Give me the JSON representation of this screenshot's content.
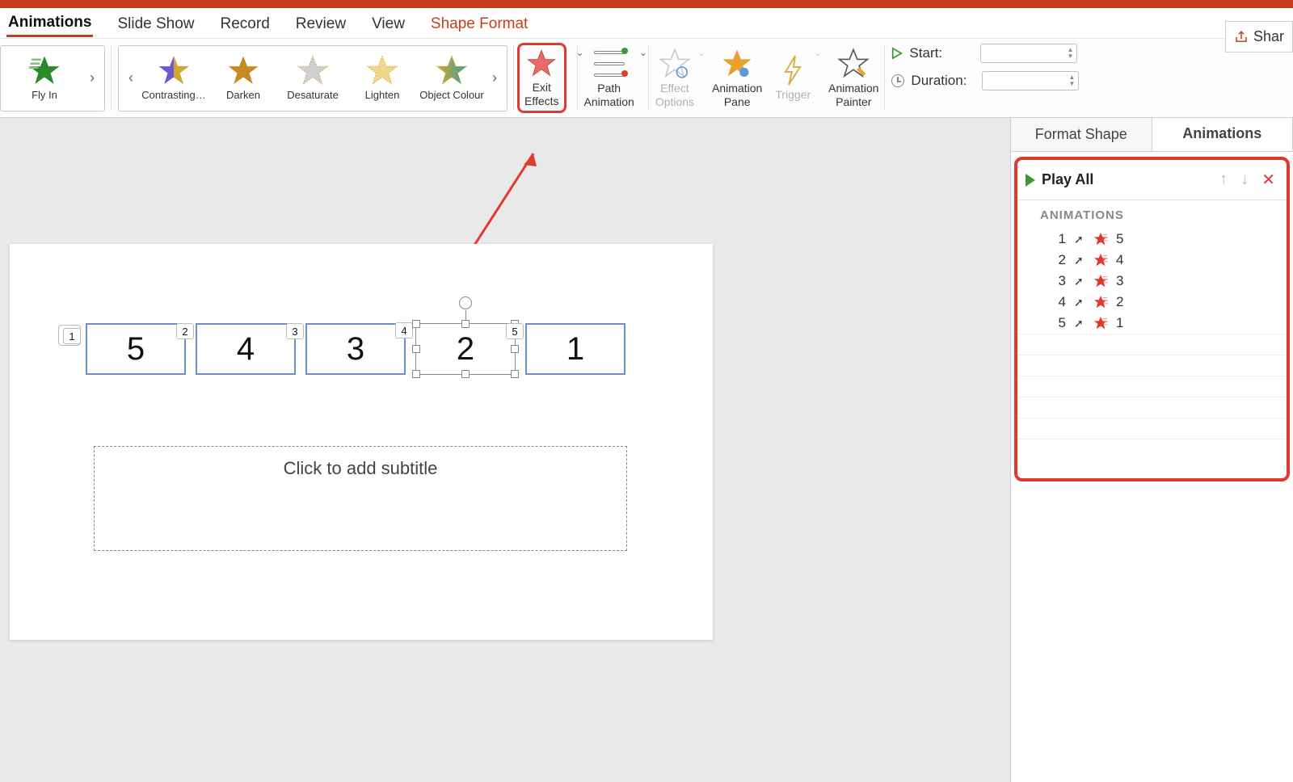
{
  "tabs": {
    "animations": "Animations",
    "slide_show": "Slide Show",
    "record": "Record",
    "review": "Review",
    "view": "View",
    "shape_format": "Shape Format"
  },
  "share": "Shar",
  "ribbon": {
    "fly_in": "Fly In",
    "emphasis": {
      "contrasting": "Contrasting…",
      "darken": "Darken",
      "desaturate": "Desaturate",
      "lighten": "Lighten",
      "object_colour": "Object Colour"
    },
    "exit_effects": "Exit\nEffects",
    "path_animation": "Path\nAnimation",
    "effect_options": "Effect\nOptions",
    "animation_pane": "Animation\nPane",
    "trigger": "Trigger",
    "animation_painter": "Animation\nPainter",
    "start": "Start:",
    "duration": "Duration:"
  },
  "side_panel": {
    "tab_format": "Format Shape",
    "tab_animations": "Animations",
    "play_all": "Play All",
    "section": "ANIMATIONS",
    "rows": [
      {
        "n": "1",
        "obj": "5"
      },
      {
        "n": "2",
        "obj": "4"
      },
      {
        "n": "3",
        "obj": "3"
      },
      {
        "n": "4",
        "obj": "2"
      },
      {
        "n": "5",
        "obj": "1"
      }
    ]
  },
  "slide": {
    "badge": "1",
    "shapes": [
      {
        "text": "5",
        "tag": "1"
      },
      {
        "text": "4",
        "tag": "2"
      },
      {
        "text": "3",
        "tag": "3"
      },
      {
        "text": "2",
        "tag": "4",
        "selected": true
      },
      {
        "text": "1",
        "tag": "5"
      }
    ],
    "subtitle_placeholder": "Click to add subtitle"
  }
}
